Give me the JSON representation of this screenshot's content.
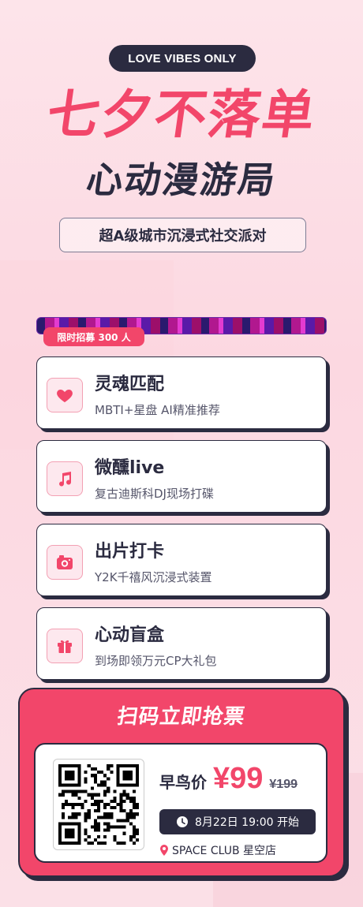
{
  "header": {
    "tagline": "LOVE VIBES ONLY",
    "title_main": "七夕不落单",
    "title_sub": "心动漫游局",
    "subtitle": "超A级城市沉浸式社交派对"
  },
  "recruit_badge": "限时招募 300 人",
  "features": [
    {
      "icon": "heart-icon",
      "title": "灵魂匹配",
      "desc": "MBTI+星盘 AI精准推荐"
    },
    {
      "icon": "music-note-icon",
      "title": "微醺live",
      "desc": "复古迪斯科DJ现场打碟"
    },
    {
      "icon": "camera-icon",
      "title": "出片打卡",
      "desc": "Y2K千禧风沉浸式装置"
    },
    {
      "icon": "gift-icon",
      "title": "心动盲盒",
      "desc": "到场即领万元CP大礼包"
    }
  ],
  "ticket": {
    "heading": "扫码立即抢票",
    "price_label": "早鸟价",
    "price": "¥99",
    "original_price": "¥199",
    "date": "8月22日 19:00 开始",
    "location": "SPACE CLUB 星空店"
  },
  "colors": {
    "accent": "#f2466a",
    "dark": "#2b2b40",
    "background": "#fde4ea"
  }
}
